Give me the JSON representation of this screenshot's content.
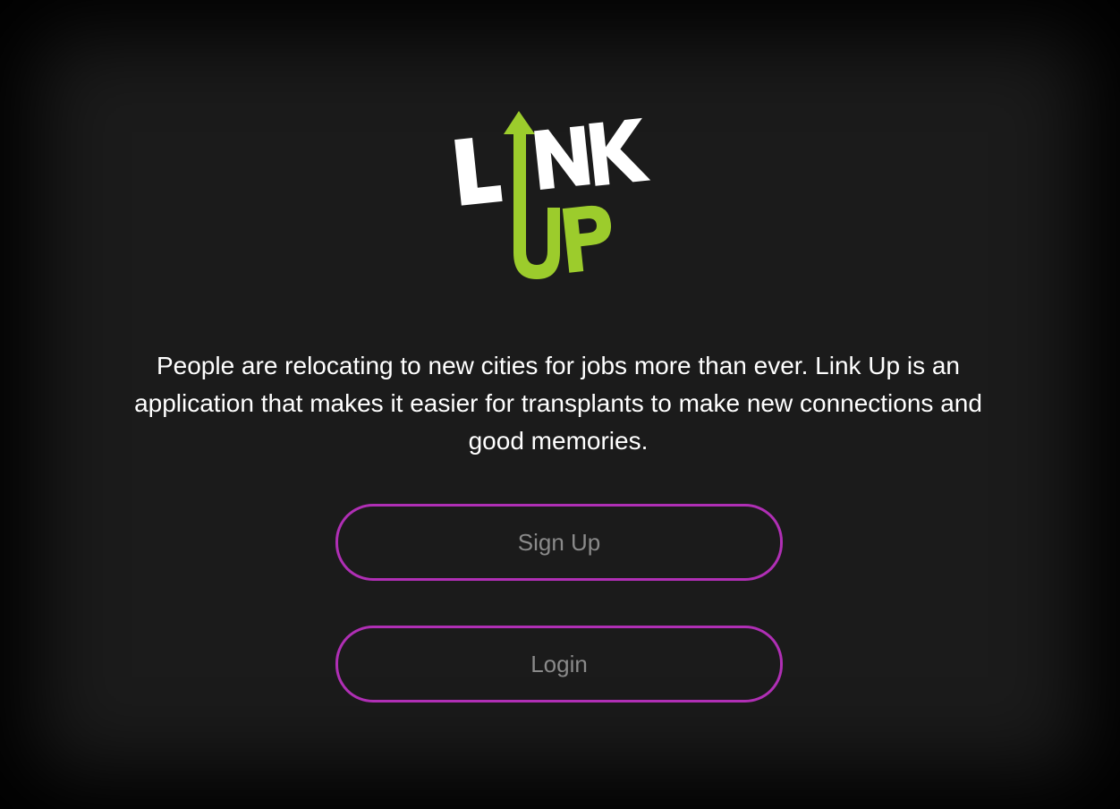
{
  "app": {
    "logo_text": "LINK UP",
    "logo_colors": {
      "text": "#ffffff",
      "accent": "#9ccc2c"
    }
  },
  "intro": {
    "tagline": "People are relocating to new cities for jobs more than ever. Link Up is an application that makes it easier for transplants to make new connections and good memories."
  },
  "actions": {
    "signup_label": "Sign Up",
    "login_label": "Login"
  },
  "colors": {
    "background": "#1b1b1b",
    "button_border": "#b02fb5",
    "button_text": "#8a8a8a"
  }
}
